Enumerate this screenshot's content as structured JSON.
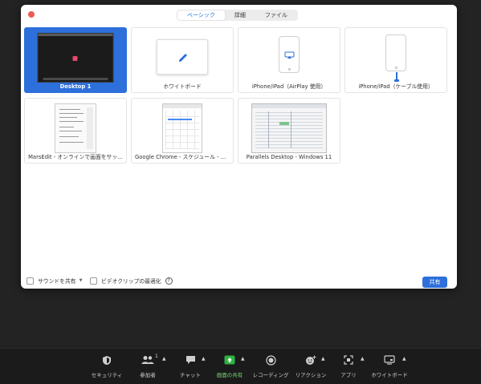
{
  "dialog": {
    "tabs": [
      {
        "label": "ベーシック",
        "active": true
      },
      {
        "label": "詳細",
        "active": false
      },
      {
        "label": "ファイル",
        "active": false
      }
    ],
    "sources": [
      {
        "label": "Desktop 1",
        "selected": true
      },
      {
        "label": "ホワイトボード"
      },
      {
        "label": "iPhone/iPad（AirPlay 使用）"
      },
      {
        "label": "iPhone/iPad（ケーブル使用）"
      },
      {
        "label": "MarsEdit - オンラインで画面をサッ…"
      },
      {
        "label": "Google Chrome - スケジュール - Go..."
      },
      {
        "label": "Parallels Desktop - Windows 11"
      }
    ],
    "footer": {
      "share_sound": "サウンドを共有",
      "optimize_video": "ビデオクリップの最適化",
      "help_glyph": "?",
      "share_button": "共有"
    }
  },
  "toolbar": {
    "participant_count": "1",
    "items": [
      {
        "label": "セキュリティ",
        "icon": "shield-icon"
      },
      {
        "label": "参加者",
        "icon": "participants-icon"
      },
      {
        "label": "チャット",
        "icon": "chat-icon"
      },
      {
        "label": "画面の共有",
        "icon": "share-screen-icon",
        "color": "#7ad87a"
      },
      {
        "label": "レコーディング",
        "icon": "record-icon"
      },
      {
        "label": "リアクション",
        "icon": "reaction-icon"
      },
      {
        "label": "アプリ",
        "icon": "apps-icon"
      },
      {
        "label": "ホワイトボード",
        "icon": "whiteboard-icon"
      }
    ]
  },
  "colors": {
    "accent": "#2d6fdb",
    "share_green": "#2fb344",
    "close_red": "#ec5c55"
  }
}
